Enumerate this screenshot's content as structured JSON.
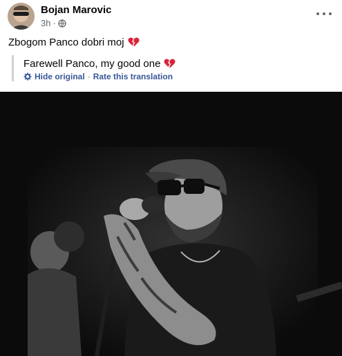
{
  "post": {
    "author": "Bojan Marovic",
    "time": "3h",
    "time_separator": "·",
    "audience_icon": "globe-icon",
    "menu_icon": "more-options-icon",
    "text": "Zbogom Panco dobri moj",
    "emoji": "broken-heart-icon"
  },
  "translation": {
    "text": "Farewell Panco, my good one",
    "emoji": "broken-heart-icon",
    "settings_icon": "gear-icon",
    "hide_label": "Hide original",
    "separator": "·",
    "rate_label": "Rate this translation"
  },
  "photo": {
    "description_icon": "performer-photo",
    "colors": {
      "background": "#0b0b0b",
      "link": "#385898",
      "muted": "#65676b"
    }
  }
}
